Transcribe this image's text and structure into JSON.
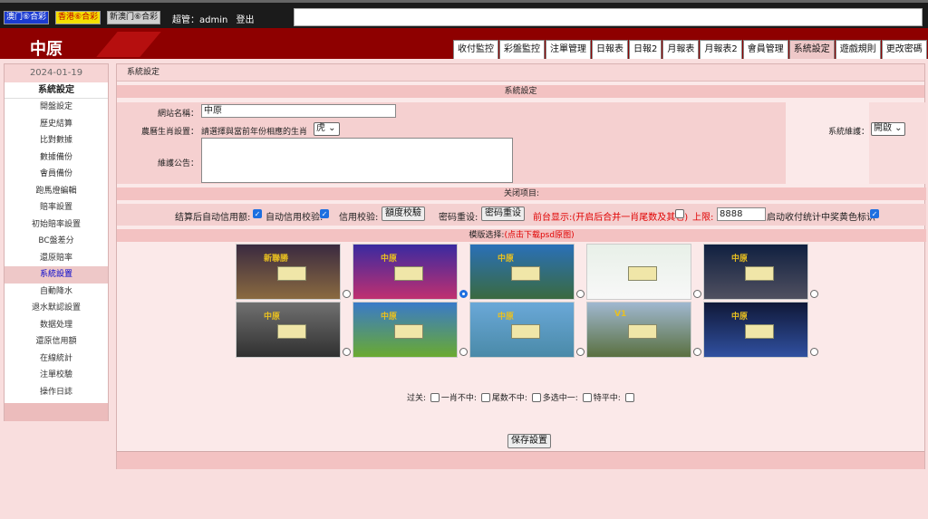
{
  "topbar": {
    "lotteries": [
      "澳门⑥合彩",
      "香港⑥合彩",
      "新澳门⑥合彩"
    ],
    "user_label": "超管：admin",
    "logout": "登出"
  },
  "brand": {
    "name": "中原"
  },
  "tabs": [
    "收付監控",
    "彩盤監控",
    "注單管理",
    "日報表",
    "日報2",
    "月報表",
    "月報表2",
    "會員管理",
    "系統設定",
    "遊戲規則",
    "更改密碼"
  ],
  "active_tab": "系統設定",
  "sidebar": {
    "date": "2024-01-19",
    "title": "系統設定",
    "items": [
      "開盤設定",
      "歷史結算",
      "比對數據",
      "數據備份",
      "會員備份",
      "跑馬燈編輯",
      "賠率設置",
      "初始賠率設置",
      "BC盤差分",
      "還原賠率",
      "系統設置",
      "自動降水",
      "退水默認設置",
      "数据处理",
      "還原信用額",
      "在線統計",
      "注單校驗",
      "操作日誌"
    ],
    "active": "系統設置"
  },
  "main": {
    "title": "系統設定",
    "section_title": "系統設定",
    "site_name_label": "網站名稱：",
    "site_name_value": "中原",
    "zodiac_label": "農曆生肖設置：",
    "zodiac_hint": "請選擇與當前年份相應的生肖",
    "zodiac_value": "虎",
    "notice_label": "維護公告：",
    "maint_label": "系統維護：",
    "maint_value": "開啟",
    "close_title": "关闭项目:",
    "close_row": {
      "auto_credit_label": "结算后自动信用额:",
      "auto_credit_checked": true,
      "auto_verify_label": "自动信用校验:",
      "auto_verify_checked": true,
      "credit_verify_label": "信用校验:",
      "credit_verify_btn": "額度校驗",
      "pwd_reset_label": "密码重设:",
      "pwd_reset_btn": "密码重设",
      "front_merge_label": "前台显示:(开启后合并一肖尾数及其它)",
      "front_merge_checked": false,
      "upper_label": "上限:",
      "upper_value": "8888",
      "yellow_label": "启动收付统计中奖黄色标识",
      "yellow_checked": true
    },
    "template_title": "模版选择:",
    "template_link": "(点击下载psd原图)",
    "templates": [
      {
        "label": "新聯勝",
        "selected": false,
        "colors": [
          "#3a2a40",
          "#8a6a40"
        ]
      },
      {
        "label": "中原",
        "selected": true,
        "colors": [
          "#3a2aa0",
          "#c03070"
        ]
      },
      {
        "label": "中原",
        "selected": false,
        "colors": [
          "#2a70b8",
          "#3a6a40"
        ]
      },
      {
        "label": "",
        "selected": false,
        "colors": [
          "#e8f0e8",
          "#f8f8f8"
        ]
      },
      {
        "label": "中原",
        "selected": false,
        "colors": [
          "#102040",
          "#505060"
        ]
      },
      {
        "label": "中原",
        "selected": false,
        "colors": [
          "#707070",
          "#303030"
        ]
      },
      {
        "label": "中原",
        "selected": false,
        "colors": [
          "#3a7ac8",
          "#6aaa30"
        ]
      },
      {
        "label": "中原",
        "selected": false,
        "colors": [
          "#6aa8d8",
          "#4a8aa8"
        ]
      },
      {
        "label": "V1",
        "selected": false,
        "colors": [
          "#a0b8d0",
          "#5a7040"
        ]
      },
      {
        "label": "中原",
        "selected": false,
        "colors": [
          "#101838",
          "#3050a0"
        ]
      }
    ],
    "bottom": {
      "pass_label": "过关:",
      "options": [
        "一肖不中:",
        "尾数不中:",
        "多选中一:",
        "特平中:"
      ]
    },
    "save_btn": "保存設置"
  }
}
